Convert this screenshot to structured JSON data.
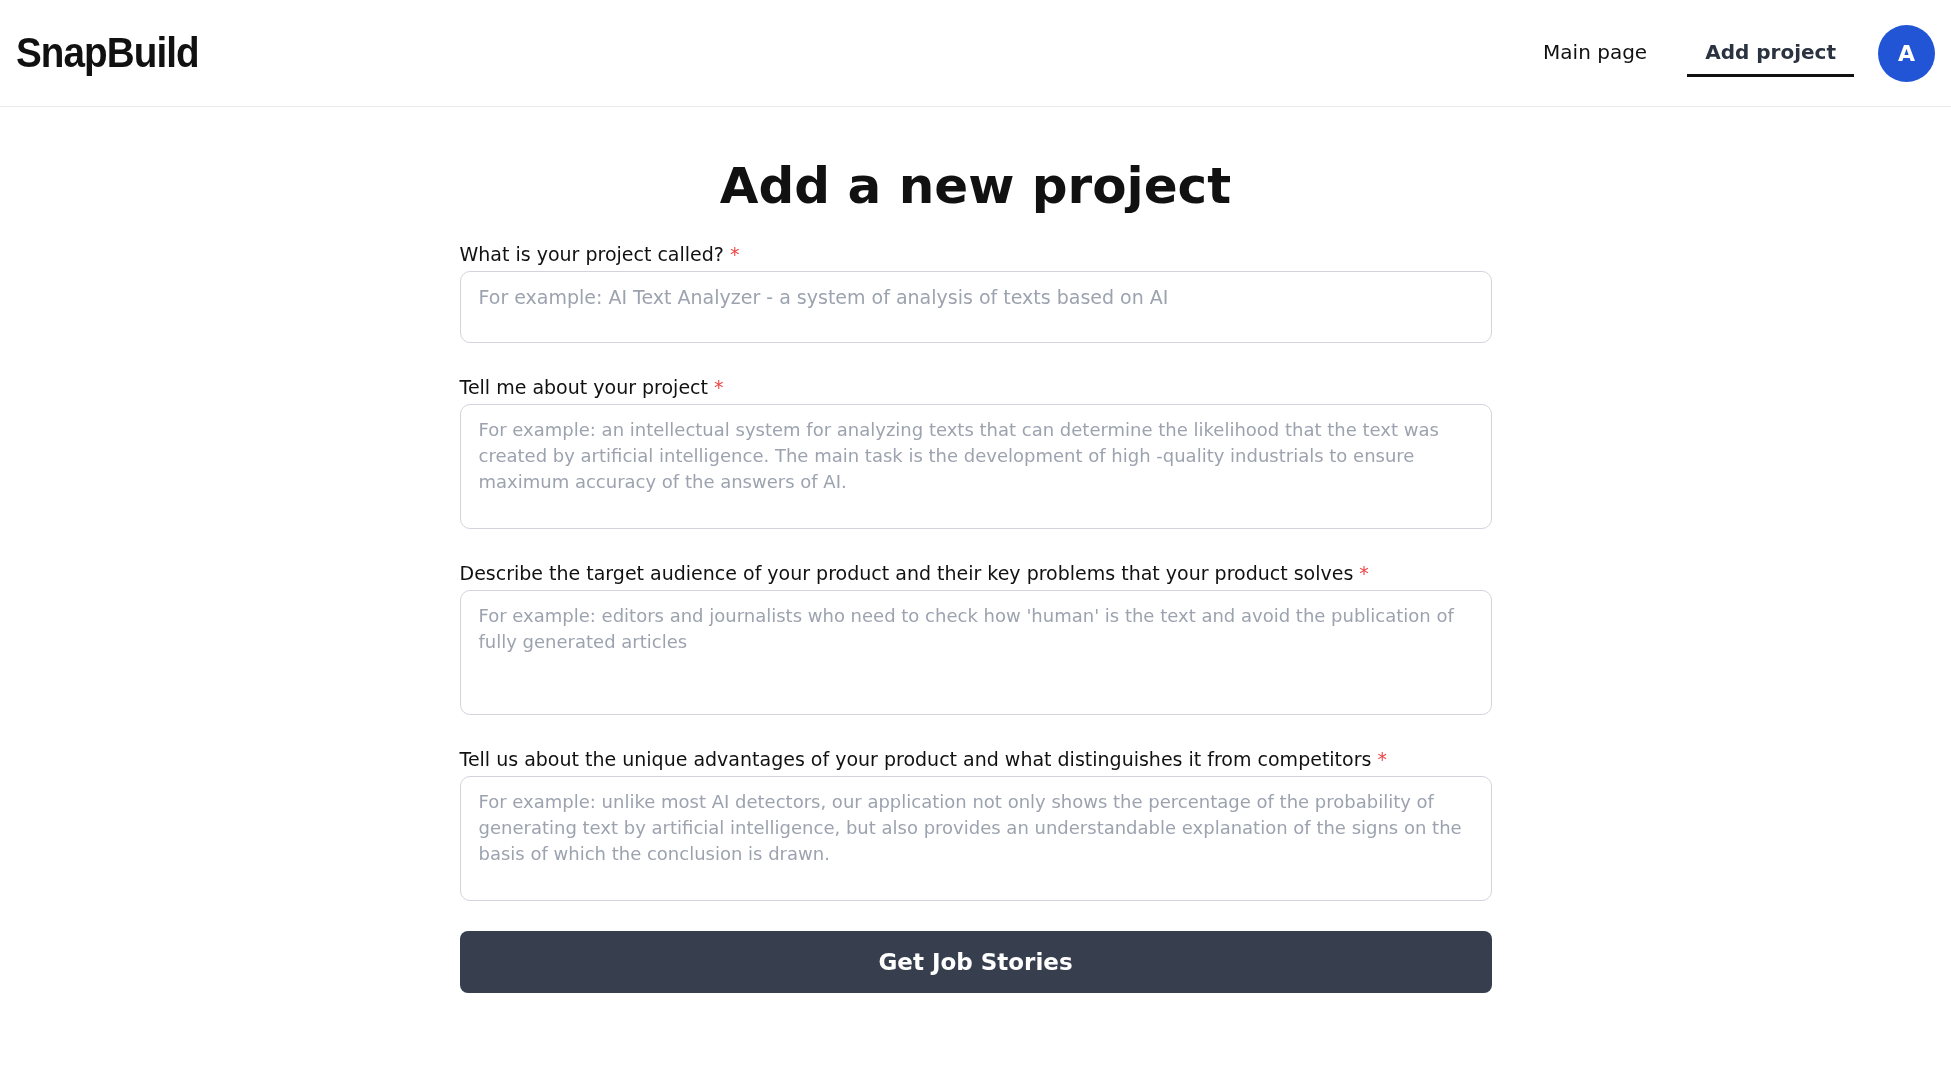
{
  "header": {
    "logo": "SnapBuild",
    "nav": [
      {
        "label": "Main page",
        "selected": false
      },
      {
        "label": "Add project",
        "selected": true
      }
    ],
    "avatar": "A"
  },
  "title": "Add a new project",
  "fields": [
    {
      "kind": "input",
      "label": "What is your project called?",
      "required_mark": "*",
      "placeholder": "For example: AI Text Analyzer - a system of analysis of texts based on AI"
    },
    {
      "kind": "textarea",
      "label": "Tell me about your project",
      "required_mark": "*",
      "placeholder": "For example: an intellectual system for analyzing texts that can determine the likelihood that the text was created by artificial intelligence. The main task is the development of high -quality industrials to ensure maximum accuracy of the answers of AI."
    },
    {
      "kind": "textarea",
      "label": "Describe the target audience of your product and their key problems that your product solves",
      "required_mark": "*",
      "placeholder": "For example: editors and journalists who need to check how 'human' is the text and avoid the publication of fully generated articles"
    },
    {
      "kind": "textarea",
      "label": "Tell us about the unique advantages of your product and what distinguishes it from competitors",
      "required_mark": "*",
      "placeholder": "For example: unlike most AI detectors, our application not only shows the percentage of the probability of generating text by artificial intelligence, but also provides an understandable explanation of the signs on the basis of which the conclusion is drawn."
    }
  ],
  "submit": "Get Job Stories"
}
